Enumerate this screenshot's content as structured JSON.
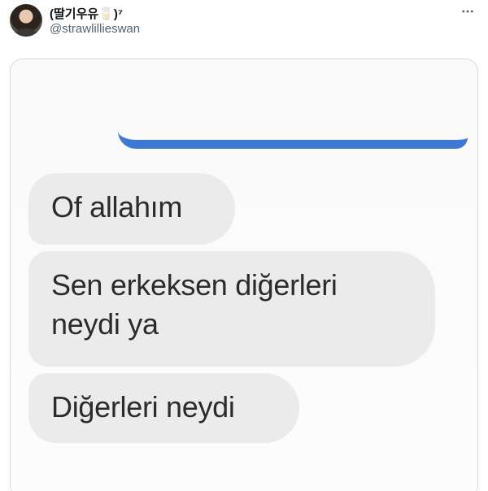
{
  "tweet": {
    "display_name": "(딸기우유🥛)⁷",
    "handle": "@strawlillieswan",
    "more_icon": "more-horizontal-icon"
  },
  "messages": {
    "sent_bubble_color": "#3f78d4",
    "received_bubble_color": "#ebebeb",
    "received": [
      {
        "line1": "Of allahım",
        "line2": ""
      },
      {
        "line1": "Sen erkeksen diğerleri",
        "line2": "neydi ya"
      },
      {
        "line1": "Diğerleri neydi",
        "line2": ""
      }
    ]
  }
}
